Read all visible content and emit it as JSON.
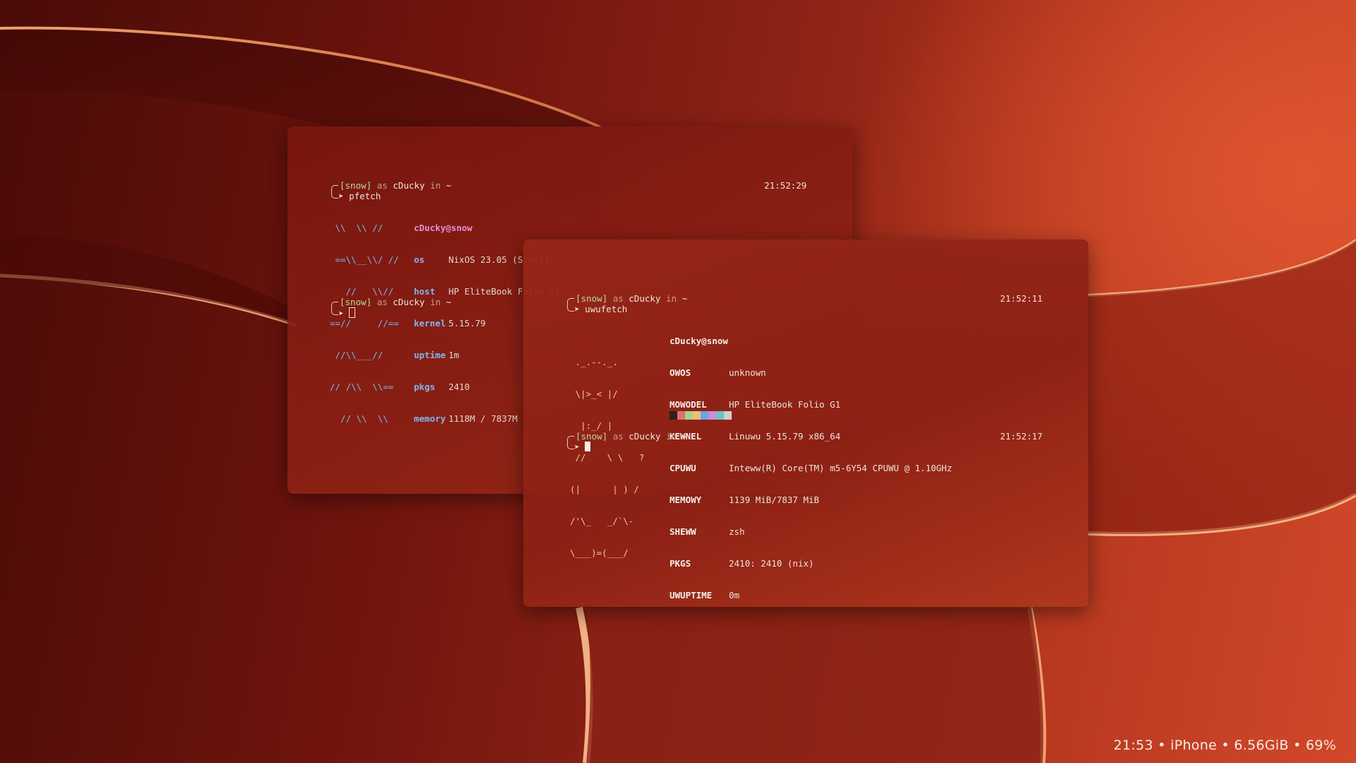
{
  "accent_colors": {
    "prompt_host": "#b9d9a2",
    "pfetch_blue": "#7eb3ee",
    "pfetch_pink": "#e68fd3",
    "background": "#8e2316"
  },
  "back_terminal": {
    "prompt1": {
      "host": "[snow]",
      "as": "as",
      "user": "cDucky",
      "in": "in",
      "dir": "~",
      "time": "21:52:29"
    },
    "command": "pfetch",
    "art": [
      " \\\\  \\\\ //",
      " ==\\\\__\\\\/ //",
      "   //   \\\\//",
      "==//     //==",
      " //\\\\___//",
      "// /\\\\  \\\\==",
      "  // \\\\  \\\\"
    ],
    "title": "cDucky@snow",
    "info": [
      {
        "key": "os",
        "value": "NixOS 23.05 (Stoat)"
      },
      {
        "key": "host",
        "value": "HP EliteBook Folio G1"
      },
      {
        "key": "kernel",
        "value": "5.15.79"
      },
      {
        "key": "uptime",
        "value": "1m"
      },
      {
        "key": "pkgs",
        "value": "2410"
      },
      {
        "key": "memory",
        "value": "1118M / 7837M"
      }
    ],
    "prompt2": {
      "host": "[snow]",
      "as": "as",
      "user": "cDucky",
      "in": "in",
      "dir": "~"
    }
  },
  "front_terminal": {
    "prompt1": {
      "host": "[snow]",
      "as": "as",
      "user": "cDucky",
      "in": "in",
      "dir": "~",
      "time": "21:52:11"
    },
    "command": "uwufetch",
    "title": "cDucky@snow",
    "art": [
      " ._.--._.",
      " \\|>_< |/",
      "  |:_/ |",
      " //    \\ \\   ?",
      "(|      | ) /",
      "/'\\_   _/`\\-",
      "\\___)=(___/"
    ],
    "info": [
      {
        "key": "OWOS",
        "value": "unknown"
      },
      {
        "key": "MOWODEL",
        "value": "HP EliteBook Folio G1"
      },
      {
        "key": "KEWNEL",
        "value": "Linuwu 5.15.79 x86_64"
      },
      {
        "key": "CPUWU",
        "value": "Inteww(R) Core(TM) m5-6Y54 CPUWU @ 1.10GHz"
      },
      {
        "key": "MEMOWY",
        "value": "1139 MiB/7837 MiB"
      },
      {
        "key": "SHEWW",
        "value": "zsh"
      },
      {
        "key": "PKGS",
        "value": "2410: 2410 (nix)"
      },
      {
        "key": "UWUPTIME",
        "value": "0m"
      }
    ],
    "palette": [
      "#2b2222",
      "#e07070",
      "#a8d18a",
      "#e6c27a",
      "#6fa3e6",
      "#c98fd8",
      "#6ec3c0",
      "#cfcfcf"
    ],
    "prompt2": {
      "host": "[snow]",
      "as": "as",
      "user": "cDucky",
      "in": "in",
      "dir": "~",
      "time": "21:52:17"
    }
  },
  "statusbar": {
    "text": "21:53 • iPhone • 6.56GiB • 69%"
  }
}
